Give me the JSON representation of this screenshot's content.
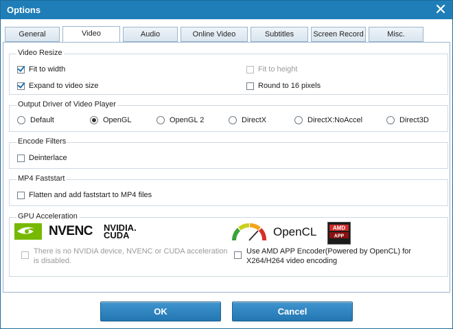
{
  "window": {
    "title": "Options"
  },
  "tabs": [
    {
      "label": "General"
    },
    {
      "label": "Video"
    },
    {
      "label": "Audio"
    },
    {
      "label": "Online Video"
    },
    {
      "label": "Subtitles"
    },
    {
      "label": "Screen Record"
    },
    {
      "label": "Misc."
    }
  ],
  "active_tab": "Video",
  "video_resize": {
    "title": "Video Resize",
    "fit_to_width": {
      "label": "Fit to width",
      "checked": true
    },
    "expand_to_video_size": {
      "label": "Expand to video size",
      "checked": true
    },
    "fit_to_height": {
      "label": "Fit to height",
      "checked": false,
      "enabled": false
    },
    "round_to_16": {
      "label": "Round to 16 pixels",
      "checked": false
    }
  },
  "output_driver": {
    "title": "Output Driver of Video Player",
    "options": [
      {
        "label": "Default"
      },
      {
        "label": "OpenGL"
      },
      {
        "label": "OpenGL 2"
      },
      {
        "label": "DirectX"
      },
      {
        "label": "DirectX:NoAccel"
      },
      {
        "label": "Direct3D"
      }
    ],
    "selected": "OpenGL"
  },
  "encode_filters": {
    "title": "Encode Filters",
    "deinterlace": {
      "label": "Deinterlace",
      "checked": false
    }
  },
  "mp4_faststart": {
    "title": "MP4 Faststart",
    "flatten": {
      "label": "Flatten and add faststart to MP4 files",
      "checked": false
    }
  },
  "gpu": {
    "title": "GPU Acceleration",
    "nvenc_logo": "NVENC",
    "nvidia_logo": "NVIDIA.",
    "cuda_logo": "CUDA",
    "opencl_logo": "OpenCL",
    "amd_logo": "AMD",
    "amd_logo_sub": "APP",
    "nvidia_text": "There is no NVIDIA device, NVENC or CUDA acceleration is disabled.",
    "nvidia_checked": false,
    "amd_text": "Use AMD APP Encoder(Powered by OpenCL) for X264/H264 video encoding",
    "amd_checked": false
  },
  "buttons": {
    "ok": "OK",
    "cancel": "Cancel"
  },
  "colors": {
    "titlebar": "#1f7eb8",
    "button": "#2b7fbf",
    "amd_red": "#d22b2b",
    "nvidia_green": "#76b900"
  }
}
